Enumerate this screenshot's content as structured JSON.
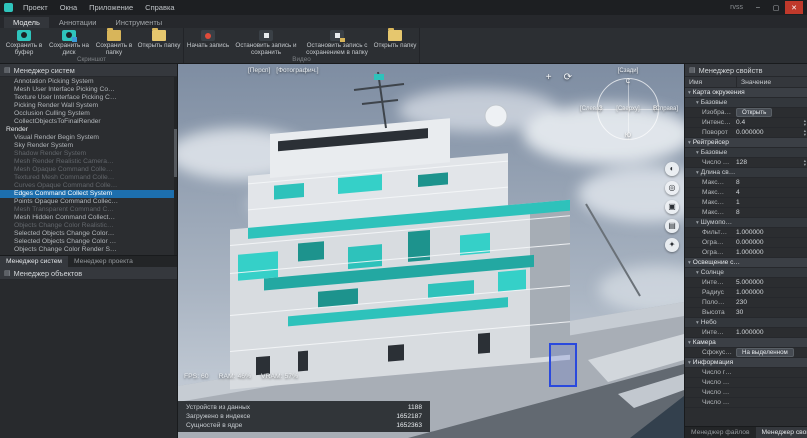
{
  "titlebar": {
    "window_title": "rvss",
    "menu": [
      "Проект",
      "Окна",
      "Приложение",
      "Справка"
    ],
    "controls": [
      {
        "name": "minimize-button",
        "glyph": "–"
      },
      {
        "name": "maximize-button",
        "glyph": "▢"
      },
      {
        "name": "close-button",
        "glyph": "✕"
      }
    ]
  },
  "ribbon": {
    "tabs": [
      "Модель",
      "Аннотации",
      "Инструменты"
    ],
    "active_tab": 0,
    "groups": [
      {
        "label": "Скриншот",
        "buttons": [
          {
            "label": "Сохранить в буфер",
            "icon": "camera"
          },
          {
            "label": "Сохранить на диск",
            "icon": "camera-disk"
          },
          {
            "label": "Сохранить в папку",
            "icon": "folder"
          },
          {
            "label": "Открыть папку",
            "icon": "folder-open"
          }
        ]
      },
      {
        "label": "Видео",
        "buttons": [
          {
            "label": "Начать запись",
            "icon": "record"
          },
          {
            "label": "Остановить запись и сохранить",
            "icon": "stop"
          },
          {
            "label": "Остановить запись с сохранением в папку",
            "icon": "stop-folder"
          },
          {
            "label": "Открыть папку",
            "icon": "folder-open"
          }
        ]
      }
    ]
  },
  "system_manager": {
    "title": "Менеджер систем",
    "items": [
      {
        "label": "Annotation Picking System",
        "state": "normal"
      },
      {
        "label": "Mesh User Interface Picking Co…",
        "state": "normal"
      },
      {
        "label": "Texture User Interface Picking C…",
        "state": "normal"
      },
      {
        "label": "Picking Render Wall System",
        "state": "normal"
      },
      {
        "label": "Occlusion Culling System",
        "state": "normal"
      },
      {
        "label": "CollectObjectsToFinalRender",
        "state": "normal"
      },
      {
        "label": "Render",
        "state": "category"
      },
      {
        "label": "Visual Render Begin System",
        "state": "normal"
      },
      {
        "label": "Sky Render System",
        "state": "normal"
      },
      {
        "label": "Shadow Render System",
        "state": "dim"
      },
      {
        "label": "Mesh Render Realistic Camera…",
        "state": "dim"
      },
      {
        "label": "Mesh Opaque Command Colle…",
        "state": "dim"
      },
      {
        "label": "Textured Mesh Command Colle…",
        "state": "dim"
      },
      {
        "label": "Curves Opaque Command Colle…",
        "state": "dim"
      },
      {
        "label": "Edges Command Collect System",
        "state": "selected"
      },
      {
        "label": "Points Opaque Command Collec…",
        "state": "normal"
      },
      {
        "label": "Mesh Transparent Command C…",
        "state": "dim"
      },
      {
        "label": "Mesh Hidden Command Collect…",
        "state": "normal"
      },
      {
        "label": "Objects Change Color Realistic…",
        "state": "dim"
      },
      {
        "label": "Selected Objects Change Color…",
        "state": "normal"
      },
      {
        "label": "Selected Objects Change Color …",
        "state": "normal"
      },
      {
        "label": "Objects Change Color Render S…",
        "state": "normal"
      }
    ],
    "tabs": [
      "Менеджер систем",
      "Менеджер проекта"
    ],
    "active_tab": 0
  },
  "object_manager": {
    "title": "Менеджер объектов"
  },
  "viewport": {
    "modes": [
      "[Персп]",
      "[Фотографич.]"
    ],
    "top_icons": [
      {
        "name": "crosshair-icon",
        "glyph": "+"
      },
      {
        "name": "orbit-icon",
        "glyph": "⟳"
      }
    ],
    "compass": {
      "back": "[Сзади]",
      "left": "[Слева]",
      "center": "[Сверху]",
      "right": "[Справа]",
      "north": "С",
      "south": "Ю",
      "west": "З",
      "east": "В"
    },
    "toolbar": [
      {
        "name": "material-sphere-icon",
        "glyph": "◐"
      },
      {
        "name": "render-sphere-icon",
        "glyph": "◎"
      },
      {
        "name": "camera-icon",
        "glyph": "▣"
      },
      {
        "name": "layers-icon",
        "glyph": "▤"
      },
      {
        "name": "effects-icon",
        "glyph": "✦"
      }
    ],
    "perf": [
      "FPS: 60",
      "RAM: 46%",
      "VRAM: 57%"
    ],
    "counters": [
      {
        "label": "Устройств из данных",
        "value": "1188"
      },
      {
        "label": "Загружено в индексе",
        "value": "1652187"
      },
      {
        "label": "Сущностей в ядре",
        "value": "1652363"
      }
    ]
  },
  "properties": {
    "title": "Менеджер свойств",
    "columns": [
      "Имя",
      "Значение"
    ],
    "rows": [
      {
        "t": "group",
        "n": "Карта окружения"
      },
      {
        "t": "sub",
        "n": "Базовые"
      },
      {
        "t": "prop",
        "n": "Изображ…",
        "v": "Открыть",
        "btn": true
      },
      {
        "t": "prop",
        "n": "Интенси…",
        "v": "0.4",
        "step": true
      },
      {
        "t": "prop",
        "n": "Поворот",
        "v": "0.000000",
        "step": true
      },
      {
        "t": "group",
        "n": "Рейтрейсер"
      },
      {
        "t": "sub",
        "n": "Базовые"
      },
      {
        "t": "prop",
        "n": "Число пр…",
        "v": "128",
        "step": true
      },
      {
        "t": "sub",
        "n": "Длина св…"
      },
      {
        "t": "prop",
        "n": "Макс…",
        "v": "8"
      },
      {
        "t": "prop",
        "n": "Макс…",
        "v": "4"
      },
      {
        "t": "prop",
        "n": "Макс…",
        "v": "1"
      },
      {
        "t": "prop",
        "n": "Макс…",
        "v": "8"
      },
      {
        "t": "sub",
        "n": "Шумопо…"
      },
      {
        "t": "prop",
        "n": "Фильт…",
        "v": "1.000000"
      },
      {
        "t": "prop",
        "n": "Огра…",
        "v": "0.000000"
      },
      {
        "t": "prop",
        "n": "Огра…",
        "v": "1.000000"
      },
      {
        "t": "group",
        "n": "Освещение с…"
      },
      {
        "t": "sub",
        "n": "Солнце"
      },
      {
        "t": "prop",
        "n": "Инте…",
        "v": "5.000000"
      },
      {
        "t": "prop",
        "n": "Радиус",
        "v": "1.000000"
      },
      {
        "t": "prop",
        "n": "Поло…",
        "v": "230"
      },
      {
        "t": "prop",
        "n": "Высота",
        "v": "30"
      },
      {
        "t": "sub",
        "n": "Небо"
      },
      {
        "t": "prop",
        "n": "Инте…",
        "v": "1.000000"
      },
      {
        "t": "group",
        "n": "Камера"
      },
      {
        "t": "prop",
        "n": "Сфокуси…",
        "v": "На выделенном",
        "btn": true
      },
      {
        "t": "group",
        "n": "Информация"
      },
      {
        "t": "prop",
        "n": "Число гл…",
        "v": ""
      },
      {
        "t": "prop",
        "n": "Число по…",
        "v": ""
      },
      {
        "t": "prop",
        "n": "Число тр…",
        "v": ""
      },
      {
        "t": "prop",
        "n": "Число об…",
        "v": ""
      }
    ],
    "tabs": [
      "Менеджер файлов",
      "Менеджер свойств"
    ],
    "active_tab": 1
  },
  "icons": {
    "chevron-down": "▾",
    "stepper-up": "▴",
    "stepper-down": "▾",
    "panel-list": "▤"
  },
  "colors": {
    "accent_teal": "#2fc4bc",
    "selection_blue": "#1d6fae",
    "highlight_outline": "#2a49dd",
    "close_red": "#c0392b"
  }
}
